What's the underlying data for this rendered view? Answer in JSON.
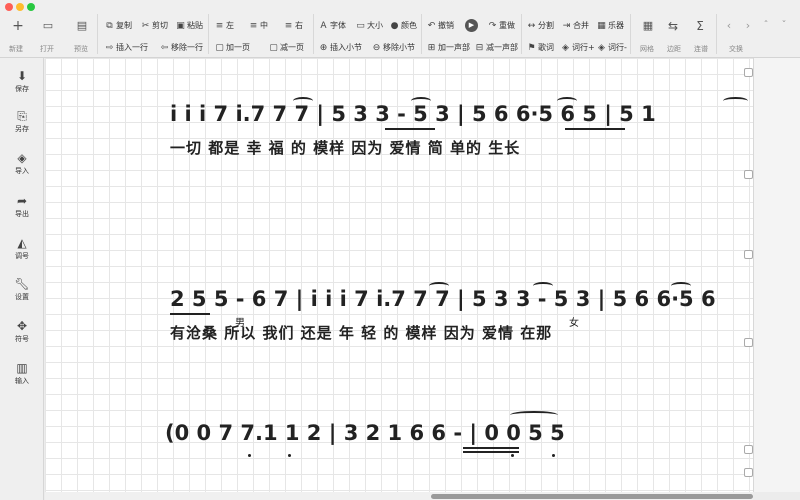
{
  "toolbar": {
    "new": {
      "icon": "plus-icon",
      "label": "新建"
    },
    "open": {
      "icon": "folder-icon",
      "label": "打开"
    },
    "preview": {
      "icon": "preview-icon",
      "label": "预览"
    },
    "copy": "复制",
    "cut": "剪切",
    "paste": "粘贴",
    "align_left": "左",
    "align_center": "中",
    "align_right": "右",
    "font": "字体",
    "size": "大小",
    "color": "颜色",
    "undo": "撤销",
    "redo": "重做",
    "split": "分割",
    "merge": "合并",
    "instrument": "乐器",
    "insert_row": "插入一行",
    "remove_row": "移除一行",
    "add_page": "加一页",
    "remove_page": "减一页",
    "insert_bar": "插入小节",
    "remove_bar": "移除小节",
    "add_voice": "加一声部",
    "remove_voice": "减一声部",
    "lyrics": "歌词",
    "lyric_row_up": "词行+",
    "lyric_row_down": "词行-",
    "grid": {
      "icon": "grid-icon",
      "label": "网格"
    },
    "margin": {
      "icon": "swap-icon",
      "label": "边距"
    },
    "beam": {
      "icon": "sigma-icon",
      "label": "连谱"
    },
    "swap": "交换"
  },
  "sidebar": [
    {
      "name": "save",
      "icon": "save-icon",
      "label": "保存"
    },
    {
      "name": "save-as",
      "icon": "save-as-icon",
      "label": "另存"
    },
    {
      "name": "import",
      "icon": "import-icon",
      "label": "导入"
    },
    {
      "name": "export",
      "icon": "export-icon",
      "label": "导出"
    },
    {
      "name": "key",
      "icon": "key-icon",
      "label": "调号"
    },
    {
      "name": "settings",
      "icon": "wrench-icon",
      "label": "设置"
    },
    {
      "name": "symbols",
      "icon": "symbols-icon",
      "label": "符号"
    },
    {
      "name": "input",
      "icon": "piano-icon",
      "label": "输入"
    }
  ],
  "score": {
    "line1": {
      "notes": "i i  i 7  i.7 7 7 | 5 3 3  -  5 3 | 5 6 6·5  6 5 | 5 1",
      "lyrics": "一切 都是 幸 福   的  模样       因为  爱情    简 单的  生长"
    },
    "line2": {
      "notes": "2 5 5 - 6 7 | i i  i 7  i.7 7 7 | 5 3 3  -  5 3 | 5 6 6·5 6",
      "lyrics": "有沧桑  所以  我们 还是 年  轻   的  模样     因为  爱情    在那",
      "marker_male": "男",
      "marker_female": "女"
    },
    "line3": {
      "notes": "(0    0 7    7.1    1 2 | 3    2 1 6    6    - | 0    0 5    5"
    }
  },
  "colors": {
    "close": "#fe5f57",
    "minimize": "#febc2e",
    "maximize": "#28c840",
    "play_button": "#555555"
  }
}
